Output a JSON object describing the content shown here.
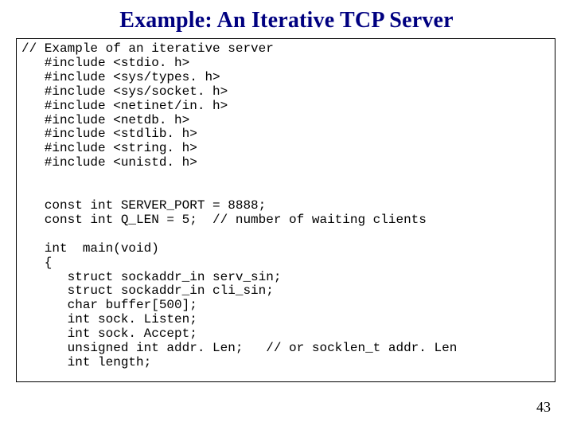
{
  "title": "Example: An Iterative TCP Server",
  "code": "// Example of an iterative server\n   #include <stdio. h>\n   #include <sys/types. h>\n   #include <sys/socket. h>\n   #include <netinet/in. h>\n   #include <netdb. h>\n   #include <stdlib. h>\n   #include <string. h>\n   #include <unistd. h>\n\n\n   const int SERVER_PORT = 8888;\n   const int Q_LEN = 5;  // number of waiting clients\n\n   int  main(void)\n   {\n      struct sockaddr_in serv_sin;\n      struct sockaddr_in cli_sin;\n      char buffer[500];\n      int sock. Listen;\n      int sock. Accept;\n      unsigned int addr. Len;   // or socklen_t addr. Len\n      int length;",
  "page_number": "43"
}
